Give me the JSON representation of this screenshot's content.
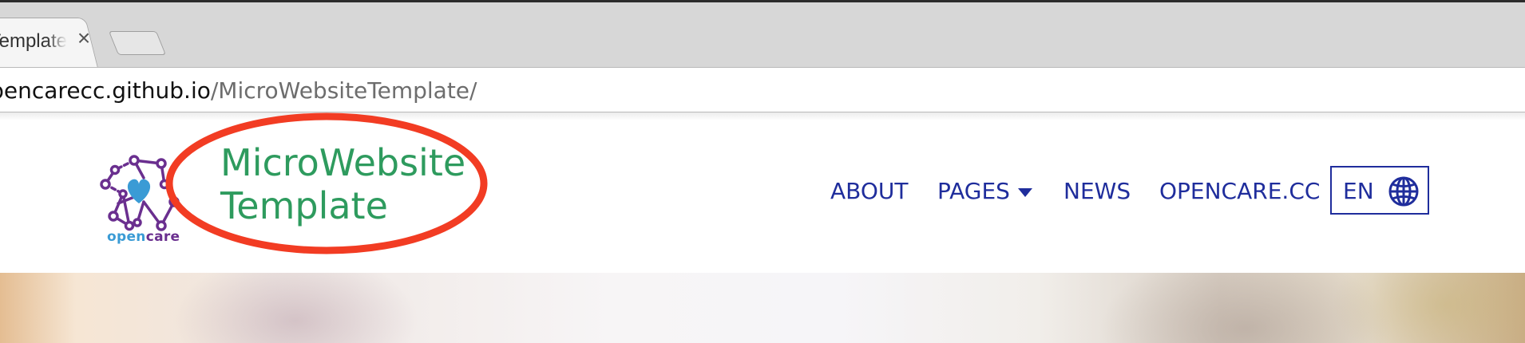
{
  "browser": {
    "tab_title": "MicroWebsite Template",
    "tab_close": "×",
    "url_host": "opencarecc.github.io",
    "url_path": "/MicroWebsiteTemplate/"
  },
  "site": {
    "logo_text_part1": "open",
    "logo_text_part2": "care",
    "title_line1": "MicroWebsite",
    "title_line2": "Template",
    "nav": {
      "about": "ABOUT",
      "pages": "PAGES",
      "news": "NEWS",
      "opencare": "OPENCARE.CC"
    },
    "language": "EN"
  },
  "colors": {
    "title_green": "#2e9b5e",
    "nav_blue": "#1f2d9c",
    "highlight_red": "#f23c23",
    "logo_purple": "#6a2f8f",
    "logo_blue": "#3a9bd5"
  },
  "icons": [
    "close-icon",
    "opencare-logo-icon",
    "heart-icon",
    "caret-down-icon",
    "globe-icon"
  ]
}
